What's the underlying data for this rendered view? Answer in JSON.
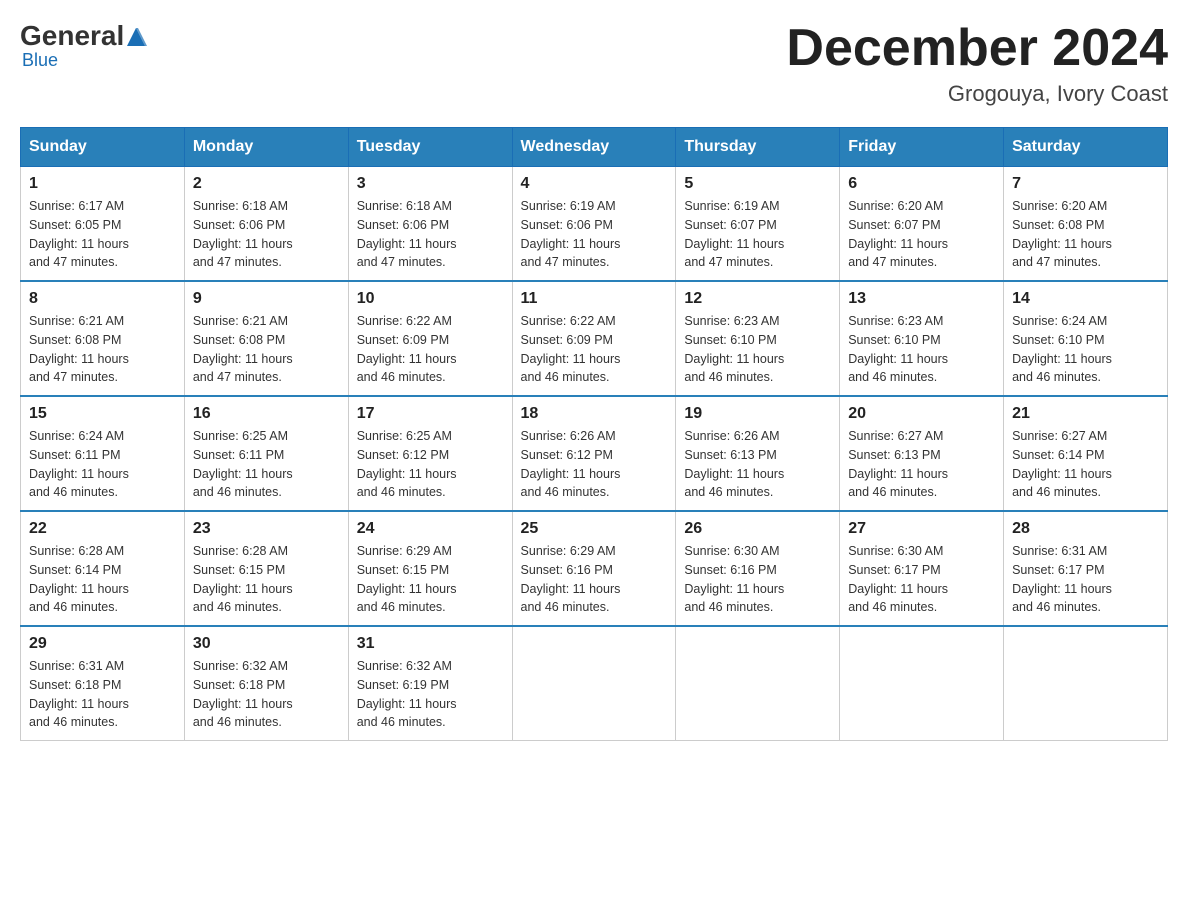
{
  "header": {
    "logo": {
      "part1": "General",
      "part2": "Blue"
    },
    "title": "December 2024",
    "location": "Grogouya, Ivory Coast"
  },
  "calendar": {
    "days_of_week": [
      "Sunday",
      "Monday",
      "Tuesday",
      "Wednesday",
      "Thursday",
      "Friday",
      "Saturday"
    ],
    "weeks": [
      [
        {
          "day": "1",
          "sunrise": "6:17 AM",
          "sunset": "6:05 PM",
          "daylight": "11 hours and 47 minutes."
        },
        {
          "day": "2",
          "sunrise": "6:18 AM",
          "sunset": "6:06 PM",
          "daylight": "11 hours and 47 minutes."
        },
        {
          "day": "3",
          "sunrise": "6:18 AM",
          "sunset": "6:06 PM",
          "daylight": "11 hours and 47 minutes."
        },
        {
          "day": "4",
          "sunrise": "6:19 AM",
          "sunset": "6:06 PM",
          "daylight": "11 hours and 47 minutes."
        },
        {
          "day": "5",
          "sunrise": "6:19 AM",
          "sunset": "6:07 PM",
          "daylight": "11 hours and 47 minutes."
        },
        {
          "day": "6",
          "sunrise": "6:20 AM",
          "sunset": "6:07 PM",
          "daylight": "11 hours and 47 minutes."
        },
        {
          "day": "7",
          "sunrise": "6:20 AM",
          "sunset": "6:08 PM",
          "daylight": "11 hours and 47 minutes."
        }
      ],
      [
        {
          "day": "8",
          "sunrise": "6:21 AM",
          "sunset": "6:08 PM",
          "daylight": "11 hours and 47 minutes."
        },
        {
          "day": "9",
          "sunrise": "6:21 AM",
          "sunset": "6:08 PM",
          "daylight": "11 hours and 47 minutes."
        },
        {
          "day": "10",
          "sunrise": "6:22 AM",
          "sunset": "6:09 PM",
          "daylight": "11 hours and 46 minutes."
        },
        {
          "day": "11",
          "sunrise": "6:22 AM",
          "sunset": "6:09 PM",
          "daylight": "11 hours and 46 minutes."
        },
        {
          "day": "12",
          "sunrise": "6:23 AM",
          "sunset": "6:10 PM",
          "daylight": "11 hours and 46 minutes."
        },
        {
          "day": "13",
          "sunrise": "6:23 AM",
          "sunset": "6:10 PM",
          "daylight": "11 hours and 46 minutes."
        },
        {
          "day": "14",
          "sunrise": "6:24 AM",
          "sunset": "6:10 PM",
          "daylight": "11 hours and 46 minutes."
        }
      ],
      [
        {
          "day": "15",
          "sunrise": "6:24 AM",
          "sunset": "6:11 PM",
          "daylight": "11 hours and 46 minutes."
        },
        {
          "day": "16",
          "sunrise": "6:25 AM",
          "sunset": "6:11 PM",
          "daylight": "11 hours and 46 minutes."
        },
        {
          "day": "17",
          "sunrise": "6:25 AM",
          "sunset": "6:12 PM",
          "daylight": "11 hours and 46 minutes."
        },
        {
          "day": "18",
          "sunrise": "6:26 AM",
          "sunset": "6:12 PM",
          "daylight": "11 hours and 46 minutes."
        },
        {
          "day": "19",
          "sunrise": "6:26 AM",
          "sunset": "6:13 PM",
          "daylight": "11 hours and 46 minutes."
        },
        {
          "day": "20",
          "sunrise": "6:27 AM",
          "sunset": "6:13 PM",
          "daylight": "11 hours and 46 minutes."
        },
        {
          "day": "21",
          "sunrise": "6:27 AM",
          "sunset": "6:14 PM",
          "daylight": "11 hours and 46 minutes."
        }
      ],
      [
        {
          "day": "22",
          "sunrise": "6:28 AM",
          "sunset": "6:14 PM",
          "daylight": "11 hours and 46 minutes."
        },
        {
          "day": "23",
          "sunrise": "6:28 AM",
          "sunset": "6:15 PM",
          "daylight": "11 hours and 46 minutes."
        },
        {
          "day": "24",
          "sunrise": "6:29 AM",
          "sunset": "6:15 PM",
          "daylight": "11 hours and 46 minutes."
        },
        {
          "day": "25",
          "sunrise": "6:29 AM",
          "sunset": "6:16 PM",
          "daylight": "11 hours and 46 minutes."
        },
        {
          "day": "26",
          "sunrise": "6:30 AM",
          "sunset": "6:16 PM",
          "daylight": "11 hours and 46 minutes."
        },
        {
          "day": "27",
          "sunrise": "6:30 AM",
          "sunset": "6:17 PM",
          "daylight": "11 hours and 46 minutes."
        },
        {
          "day": "28",
          "sunrise": "6:31 AM",
          "sunset": "6:17 PM",
          "daylight": "11 hours and 46 minutes."
        }
      ],
      [
        {
          "day": "29",
          "sunrise": "6:31 AM",
          "sunset": "6:18 PM",
          "daylight": "11 hours and 46 minutes."
        },
        {
          "day": "30",
          "sunrise": "6:32 AM",
          "sunset": "6:18 PM",
          "daylight": "11 hours and 46 minutes."
        },
        {
          "day": "31",
          "sunrise": "6:32 AM",
          "sunset": "6:19 PM",
          "daylight": "11 hours and 46 minutes."
        },
        null,
        null,
        null,
        null
      ]
    ],
    "labels": {
      "sunrise": "Sunrise:",
      "sunset": "Sunset:",
      "daylight": "Daylight:"
    }
  }
}
